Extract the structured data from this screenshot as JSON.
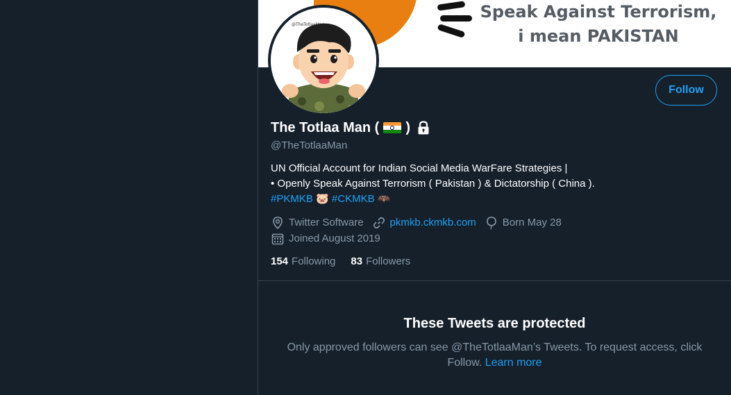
{
  "banner": {
    "line1": "Speak Against Terrorism,",
    "line2": "i mean PAKISTAN",
    "colors": {
      "orange": "#e87f10",
      "text": "#555c63"
    }
  },
  "avatar": {
    "alt": "profile-avatar",
    "caption": "@TheTotlaaMan"
  },
  "follow_button": {
    "label": "Follow"
  },
  "profile": {
    "name": "The Totlaa Man (",
    "name_close": ")",
    "flag": "india-flag-icon",
    "lock": "lock-icon",
    "handle": "@TheTotlaaMan"
  },
  "bio": {
    "line1": "UN Official Account for Indian Social Media WarFare Strategies |",
    "line2": "• Openly Speak Against Terrorism ( Pakistan ) & Dictatorship ( China ).",
    "hashtag1": "#PKMKB",
    "hashtag2": "#CKMKB",
    "emoji1": "🐷",
    "emoji2": "🦇"
  },
  "meta": {
    "location": "Twitter Software",
    "website": "pkmkb.ckmkb.com",
    "birthday": "Born May 28",
    "joined": "Joined August 2019"
  },
  "stats": {
    "following_count": "154",
    "following_label": "Following",
    "followers_count": "83",
    "followers_label": "Followers"
  },
  "protected": {
    "title": "These Tweets are protected",
    "text": "Only approved followers can see @TheTotlaaMan’s Tweets. To request access, click Follow.",
    "learn_more": "Learn more"
  },
  "colors": {
    "background": "#15202b",
    "accent": "#1da1f2",
    "secondary_text": "#8899a6",
    "border": "#38444d"
  }
}
